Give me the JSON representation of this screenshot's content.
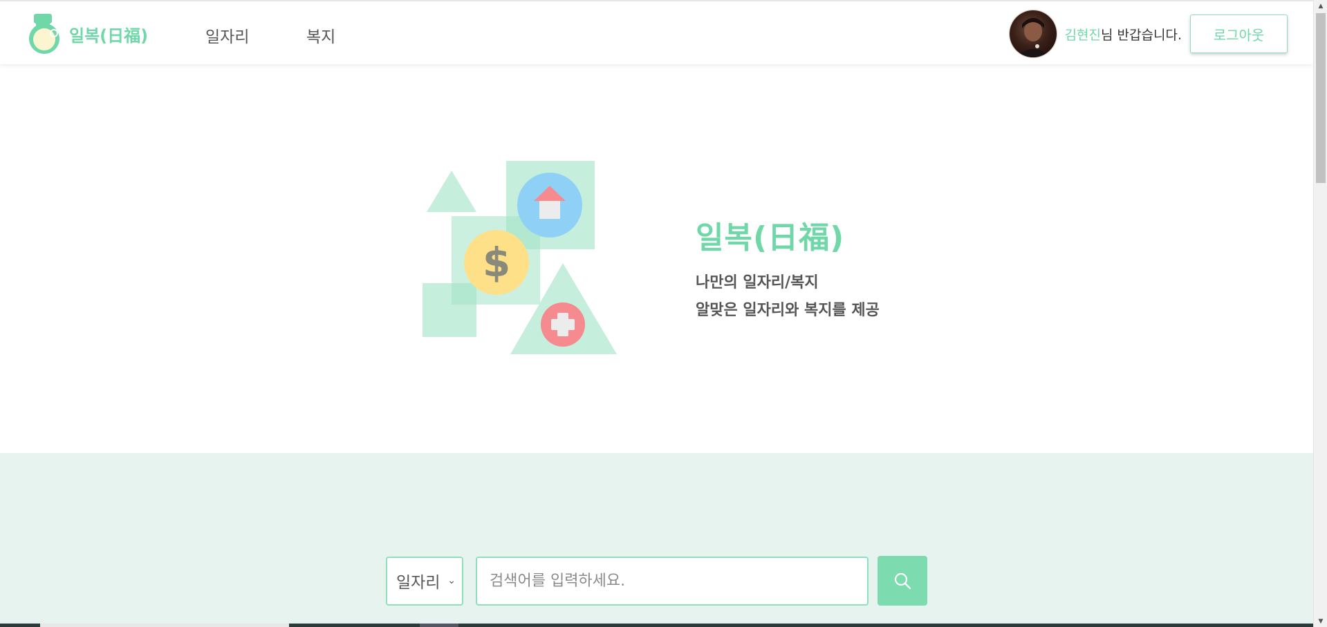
{
  "header": {
    "logo_text": "일복(日福)",
    "nav": [
      {
        "label": "일자리"
      },
      {
        "label": "복지"
      }
    ],
    "user": {
      "name": "김현진",
      "greeting_suffix": "님 반갑습니다."
    },
    "logout_label": "로그아웃"
  },
  "hero": {
    "title": "일복(日福)",
    "lines": [
      "나만의 일자리/복지",
      "알맞은 일자리와 복지를 제공"
    ]
  },
  "search": {
    "category_selected": "일자리",
    "placeholder": "검색어를 입력하세요."
  },
  "icons": {
    "logo": "pouch-logo-icon",
    "search": "search-icon",
    "illustration": [
      "house-icon",
      "dollar-icon",
      "medical-cross-icon"
    ]
  },
  "colors": {
    "accent": "#6fd7a8",
    "mint_light": "#c5eedd",
    "section_bg": "#e7f3ef",
    "house_circle": "#8fd0f7",
    "coin": "#fde087",
    "cross_circle": "#f58a8f"
  }
}
